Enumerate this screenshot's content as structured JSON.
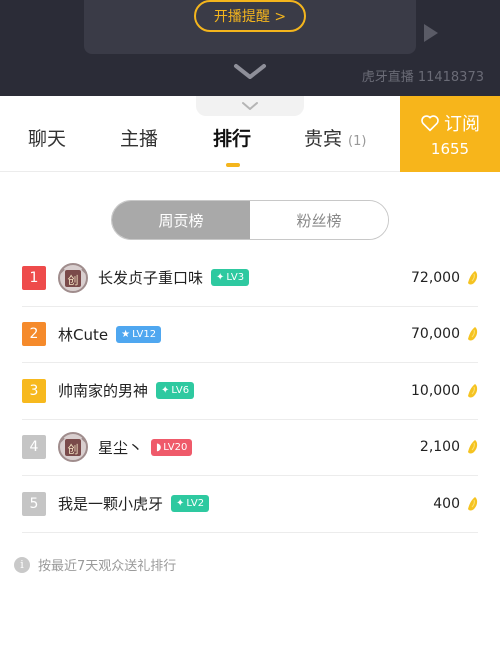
{
  "player": {
    "remind_label": "开播提醒 >",
    "room_id": "虎牙直播 11418373"
  },
  "tabs": [
    {
      "label": "聊天"
    },
    {
      "label": "主播"
    },
    {
      "label": "排行"
    },
    {
      "label": "贵宾",
      "count": "(1)"
    }
  ],
  "subscribe": {
    "label": "订阅",
    "count": "1655"
  },
  "segment": {
    "weekly": "周贡榜",
    "fans": "粉丝榜"
  },
  "ranking": [
    {
      "rank": "1",
      "name": "长发贞子重口味",
      "level": "LV3",
      "score": "72,000",
      "rank_color": "#ee4b4b",
      "badge_color": "#2ec9a0",
      "has_avatar": true
    },
    {
      "rank": "2",
      "name": "林Cute",
      "level": "LV12",
      "score": "70,000",
      "rank_color": "#f58a2b",
      "badge_color": "#4fa7f0",
      "has_avatar": false
    },
    {
      "rank": "3",
      "name": "帅南家的男神",
      "level": "LV6",
      "score": "10,000",
      "rank_color": "#f7b91e",
      "badge_color": "#2ec9a0",
      "has_avatar": false
    },
    {
      "rank": "4",
      "name": "星尘丶",
      "level": "LV20",
      "score": "2,100",
      "rank_color": "#c5c5c5",
      "badge_color": "#ef5a6a",
      "has_avatar": true
    },
    {
      "rank": "5",
      "name": "我是一颗小虎牙",
      "level": "LV2",
      "score": "400",
      "rank_color": "#c5c5c5",
      "badge_color": "#2ec9a0",
      "has_avatar": false
    }
  ],
  "note": "按最近7天观众送礼排行"
}
